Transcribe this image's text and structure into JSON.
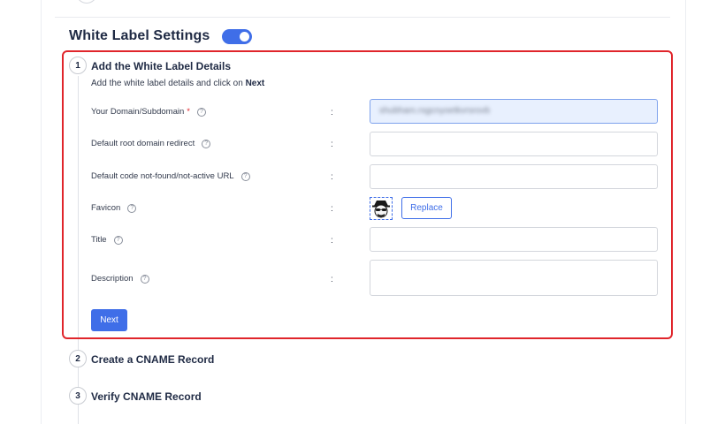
{
  "header": {
    "title": "White Label Settings",
    "toggle_on": true,
    "accent": "#3f6ee8"
  },
  "steps": [
    {
      "number": "1",
      "title": "Add the White Label Details",
      "description_prefix": "Add the white label details and click on ",
      "description_bold": "Next",
      "fields": {
        "domain": {
          "label": "Your Domain/Subdomain",
          "required_mark": "*",
          "value": "shubham.rsgcnyoetkvrsrovb"
        },
        "root_redirect": {
          "label": "Default root domain redirect",
          "value": ""
        },
        "not_found": {
          "label": "Default code not-found/not-active URL",
          "value": ""
        },
        "favicon": {
          "label": "Favicon",
          "icon": "spy-glasses-favicon",
          "replace_label": "Replace"
        },
        "title": {
          "label": "Title",
          "value": ""
        },
        "description": {
          "label": "Description",
          "value": ""
        }
      },
      "colon": ":",
      "help_glyph": "?",
      "next_label": "Next"
    },
    {
      "number": "2",
      "title": "Create a CNAME Record"
    },
    {
      "number": "3",
      "title": "Verify CNAME Record"
    }
  ],
  "colors": {
    "highlight": "#e0252b",
    "primary": "#3f6ee8",
    "text": "#1f2a44"
  }
}
